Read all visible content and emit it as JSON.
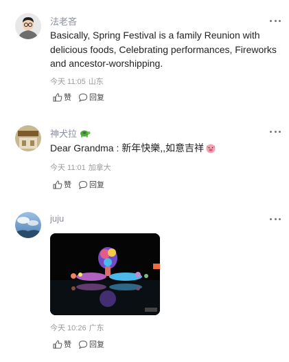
{
  "comments": [
    {
      "user": "法老吝",
      "text": "Basically, Spring Festival is a family Reunion with delicious foods, Celebrating performances, Fireworks and ancestor-worshipping.",
      "time": "今天 11:05",
      "location": "山东",
      "like_label": "赞",
      "reply_label": "回复"
    },
    {
      "user": "神犬拉",
      "user_badge_icon": "turtle-emoji",
      "text": "Dear Grandma : 新年快樂,,如意吉祥",
      "text_emoji_icon": "pig-emoji",
      "time": "今天 11:01",
      "location": "加拿大",
      "like_label": "赞",
      "reply_label": "回复"
    },
    {
      "user": "juju",
      "image": "lantern-festival-night-photo",
      "time": "今天 10:26",
      "location": "广东",
      "like_label": "赞",
      "reply_label": "回复"
    }
  ],
  "colors": {
    "username": "#8a8fa0",
    "meta": "#9a9a9a",
    "text": "#222222"
  }
}
